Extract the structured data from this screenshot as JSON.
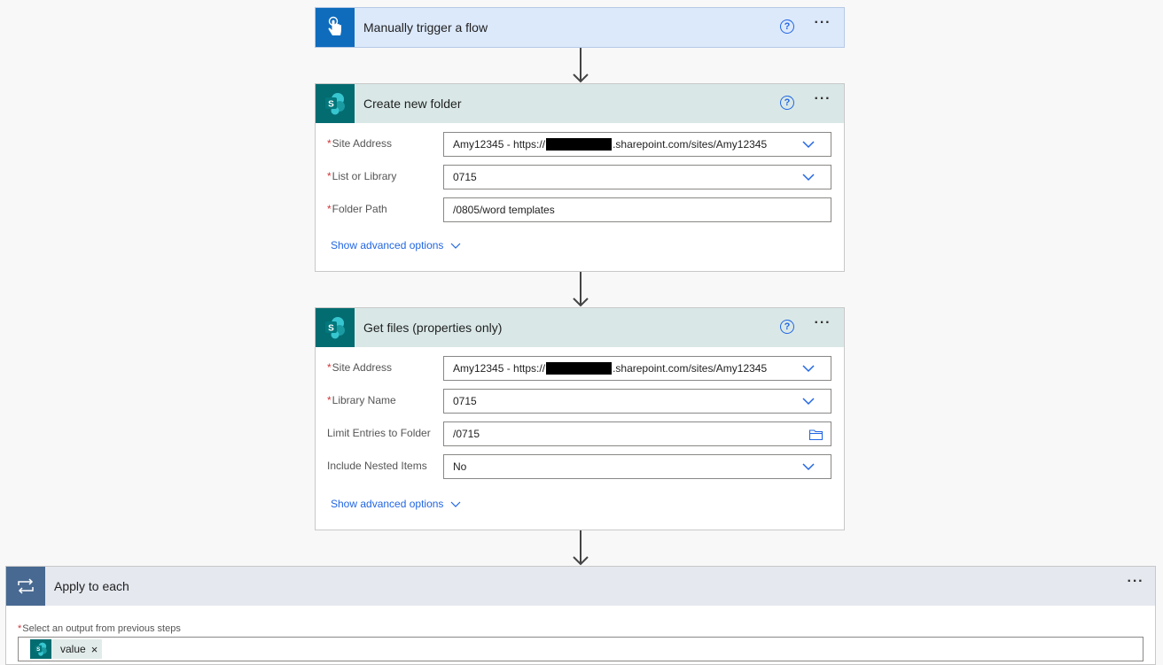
{
  "trigger": {
    "title": "Manually trigger a flow"
  },
  "create_folder": {
    "title": "Create new folder",
    "fields": [
      {
        "label": "Site Address",
        "required": true,
        "value_prefix": "Amy12345 - https://",
        "value_suffix": ".sharepoint.com/sites/Amy12345"
      },
      {
        "label": "List or Library",
        "required": true,
        "value": "0715"
      },
      {
        "label": "Folder Path",
        "required": true,
        "value": "/0805/word templates"
      }
    ],
    "advanced": "Show advanced options"
  },
  "get_files": {
    "title": "Get files (properties only)",
    "fields": [
      {
        "label": "Site Address",
        "required": true,
        "value_prefix": "Amy12345 - https://",
        "value_suffix": ".sharepoint.com/sites/Amy12345"
      },
      {
        "label": "Library Name",
        "required": true,
        "value": "0715"
      },
      {
        "label": "Limit Entries to Folder",
        "required": false,
        "value": "/0715"
      },
      {
        "label": "Include Nested Items",
        "required": false,
        "value": "No"
      }
    ],
    "advanced": "Show advanced options"
  },
  "apply_each": {
    "title": "Apply to each",
    "select_label": "Select an output from previous steps",
    "token": "value",
    "token_remove": "×"
  },
  "colors": {
    "trigger_header": "#dce9fb",
    "trigger_icon": "#0f6cbd",
    "sharepoint_header": "#d9e8e7",
    "sharepoint_icon": "#036c70",
    "apply_header": "#e5e8ef",
    "apply_icon": "#486991",
    "link": "#2266e3"
  }
}
